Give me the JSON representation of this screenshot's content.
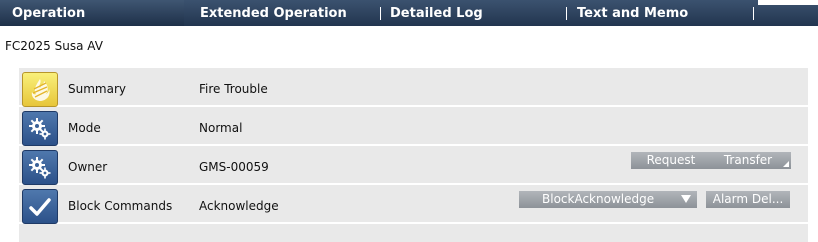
{
  "tabs": [
    {
      "label": "Operation",
      "active": true
    },
    {
      "label": "Extended Operation",
      "active": false
    },
    {
      "label": "Detailed Log",
      "active": false
    },
    {
      "label": "Text and Memo",
      "active": false
    }
  ],
  "object_title": "FC2025 Susa AV",
  "rows": [
    {
      "label": "Summary",
      "value": "Fire Trouble",
      "icon": "fire-icon"
    },
    {
      "label": "Mode",
      "value": "Normal",
      "icon": "gears-icon"
    },
    {
      "label": "Owner",
      "value": "GMS-00059",
      "icon": "gears-icon"
    },
    {
      "label": "Block Commands",
      "value": "Acknowledge",
      "icon": "checkmark-icon"
    }
  ],
  "buttons": {
    "request": "Request",
    "transfer": "Transfer",
    "block_select": "BlockAcknowledge",
    "alarm_del": "Alarm Del..."
  },
  "colors": {
    "tabbar": "#22354f",
    "panel": "#e9e9e9",
    "button": "#9ca0a5",
    "icon_blue": "#3a6198",
    "icon_fire": "#f1dc52"
  }
}
